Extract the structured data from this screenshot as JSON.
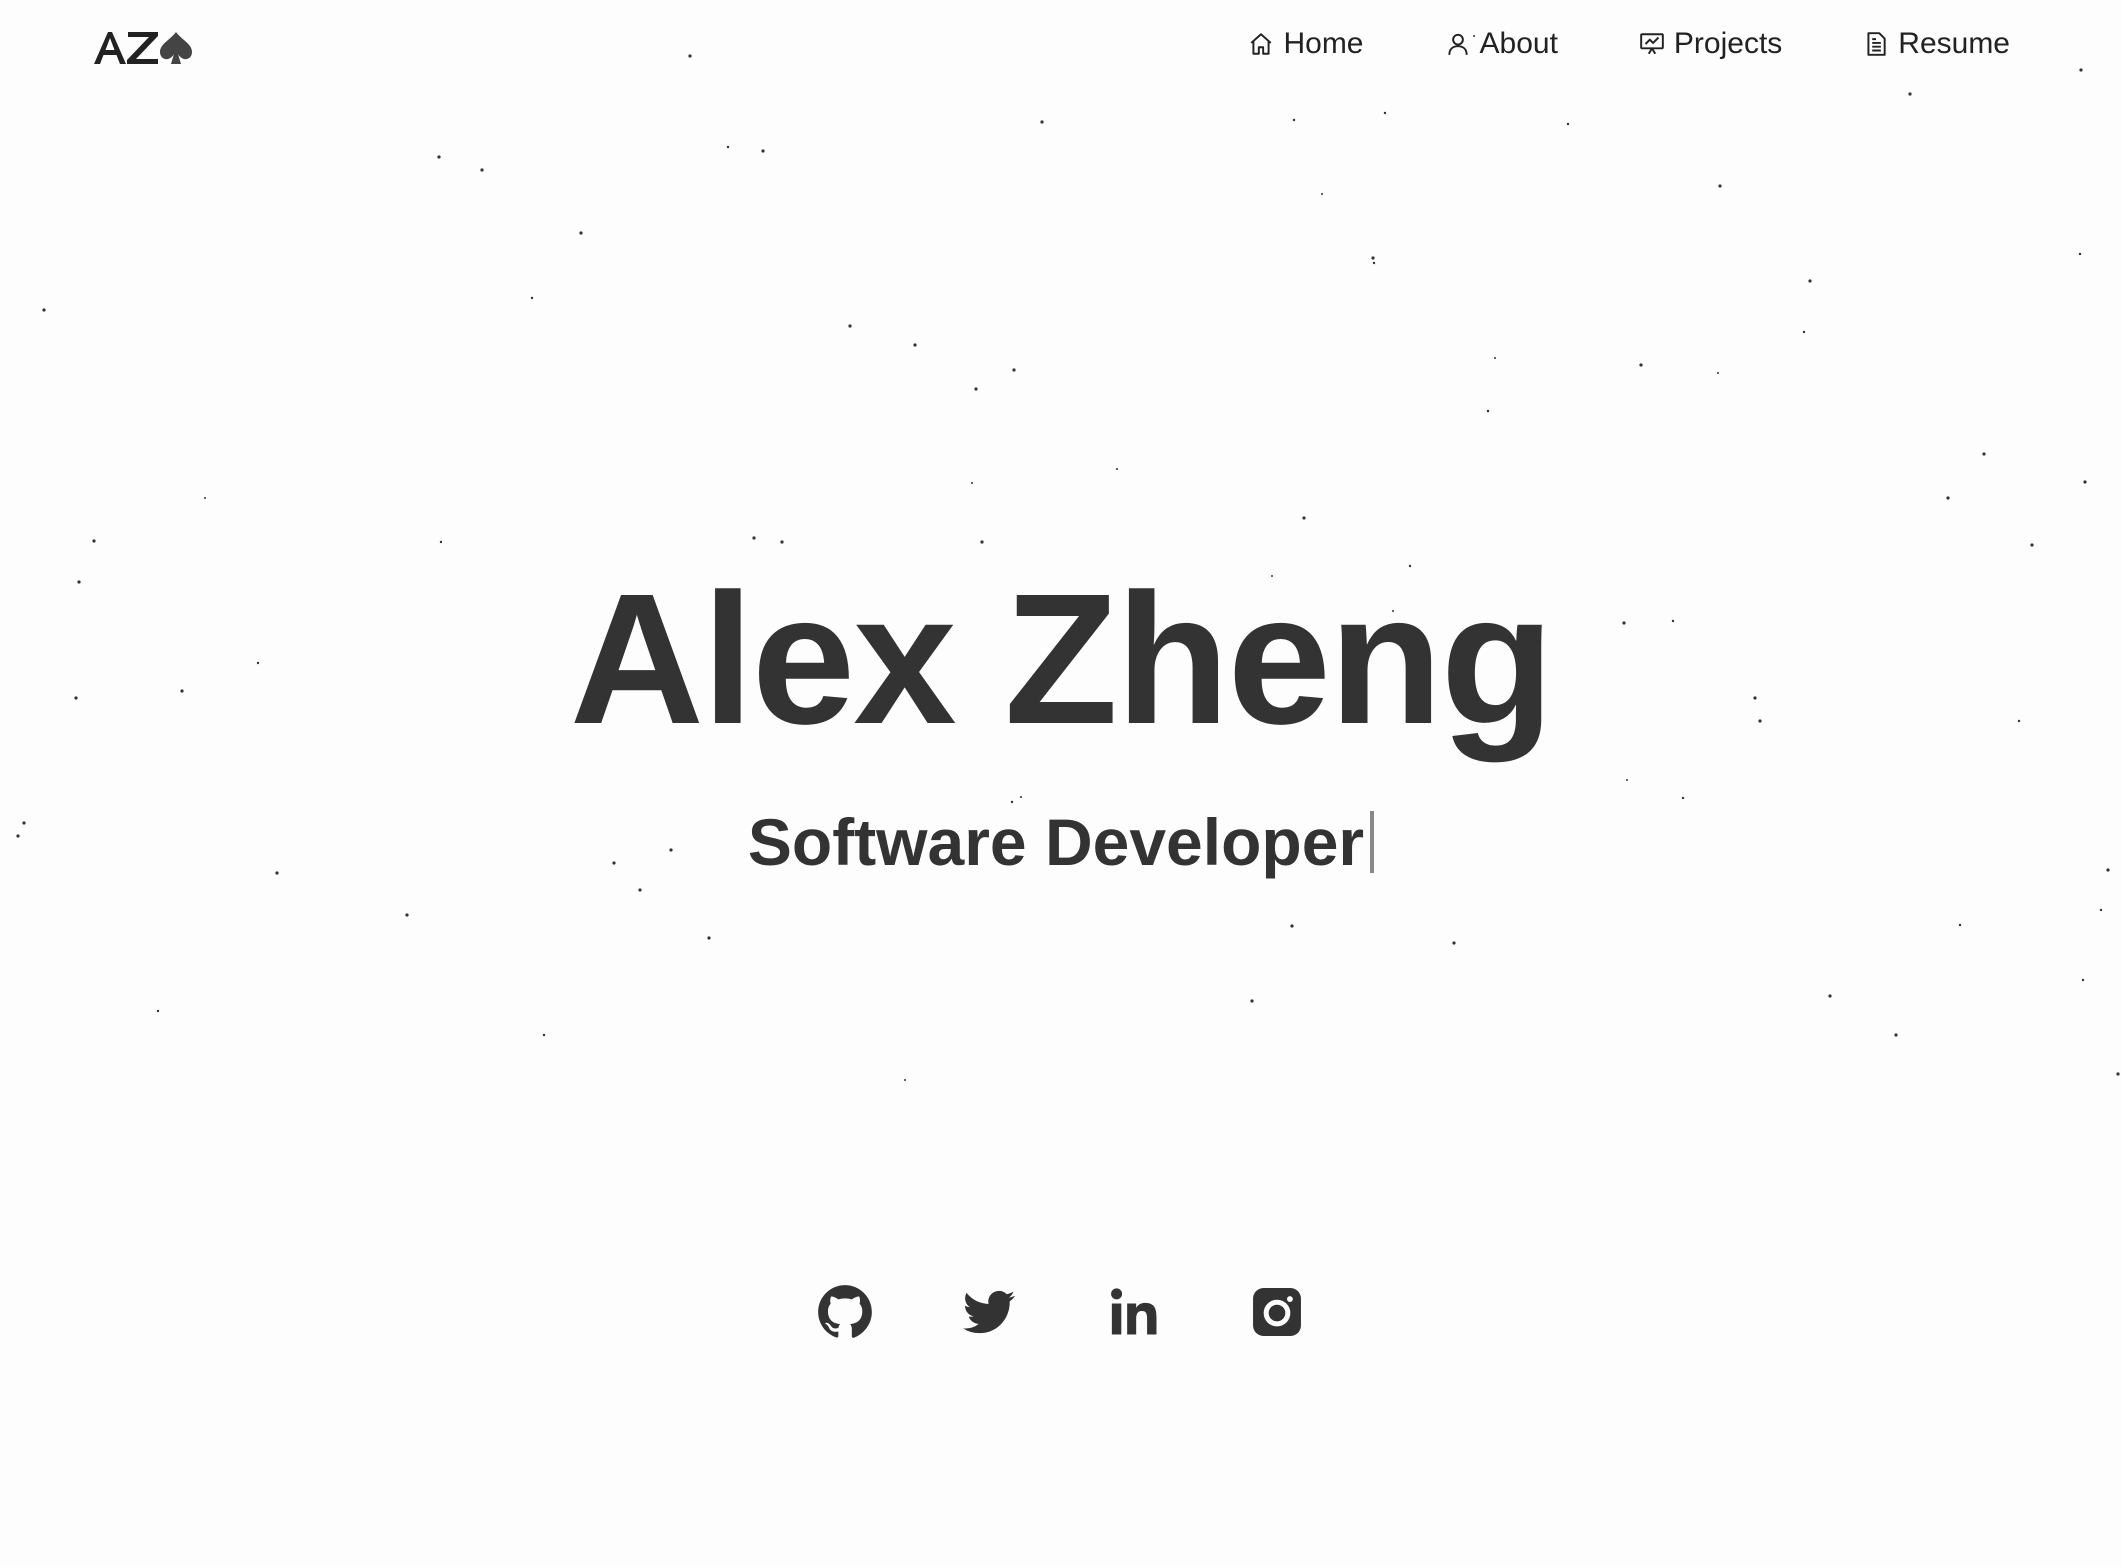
{
  "brand": {
    "logo_text": "AZ",
    "colors": {
      "text": "#333333",
      "background": "#fdfdfd",
      "accent": "#222222"
    }
  },
  "nav": {
    "items": [
      {
        "label": "Home",
        "icon": "home-icon"
      },
      {
        "label": "About",
        "icon": "user-icon"
      },
      {
        "label": "Projects",
        "icon": "presentation-chart-icon"
      },
      {
        "label": "Resume",
        "icon": "document-icon"
      }
    ]
  },
  "hero": {
    "name": "Alex Zheng",
    "role": "Software Developer"
  },
  "social": [
    {
      "icon": "github-icon"
    },
    {
      "icon": "twitter-icon"
    },
    {
      "icon": "linkedin-icon"
    },
    {
      "icon": "instagram-icon"
    }
  ]
}
